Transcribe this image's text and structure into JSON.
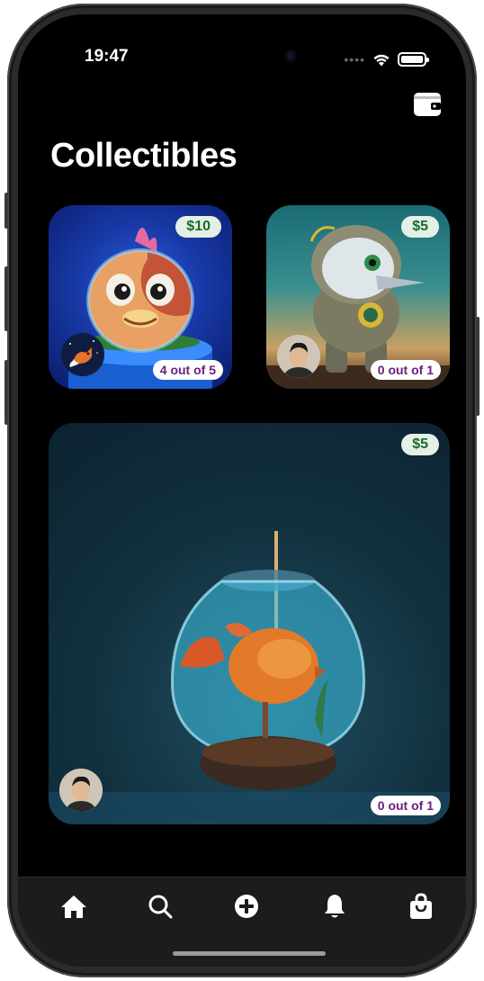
{
  "status_bar": {
    "time": "19:47",
    "dots": "••••"
  },
  "header": {
    "title": "Collectibles",
    "wallet_icon": "wallet-icon"
  },
  "collectibles": [
    {
      "name": "fish-on-pedestal",
      "price": "$10",
      "ownership": "4 out of 5",
      "creator_avatar": "fox-avatar"
    },
    {
      "name": "astronaut-bird",
      "price": "$5",
      "ownership": "0 out of 1",
      "creator_avatar": "person-avatar"
    },
    {
      "name": "goldfish-in-bowl",
      "price": "$5",
      "ownership": "0 out of 1",
      "creator_avatar": "person-avatar"
    }
  ],
  "tab_bar": [
    {
      "icon": "home-icon"
    },
    {
      "icon": "search-icon"
    },
    {
      "icon": "add-icon"
    },
    {
      "icon": "bell-icon"
    },
    {
      "icon": "shopping-bag-icon"
    }
  ],
  "colors": {
    "background": "#000000",
    "price_badge_bg": "#e4efe6",
    "price_text": "#1b6a2a",
    "ownership_text": "#6b1e80",
    "tab_bar_bg": "#1c1c1e"
  }
}
